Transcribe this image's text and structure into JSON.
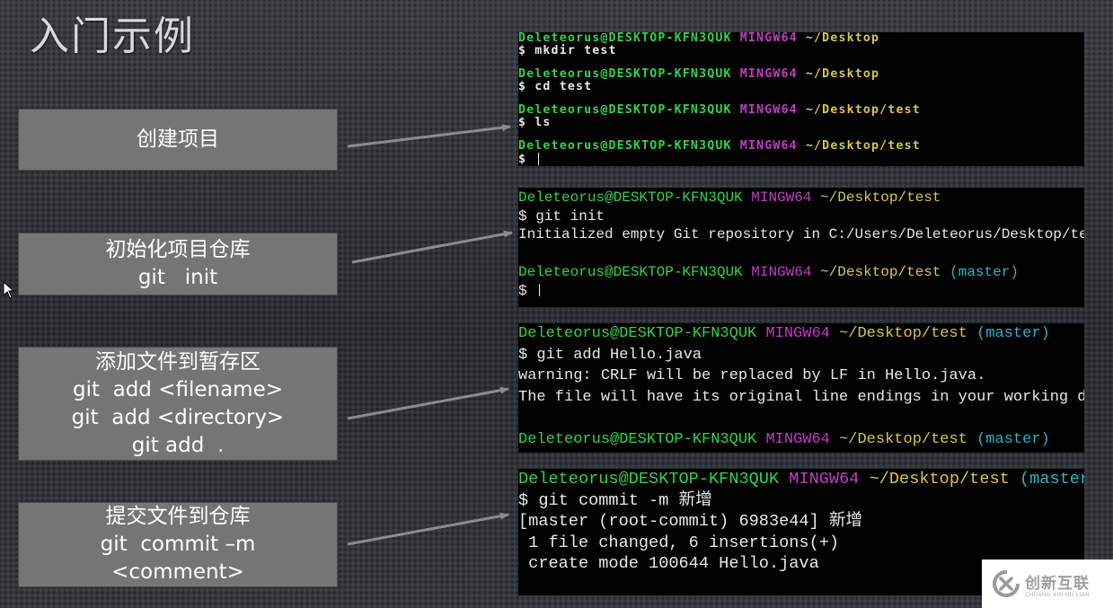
{
  "slide": {
    "title": "入门示例"
  },
  "steps": [
    {
      "lines": [
        "创建项目"
      ]
    },
    {
      "lines": [
        "初始化项目仓库",
        "git   init"
      ]
    },
    {
      "lines": [
        "添加文件到暂存区",
        "git  add <filename>",
        "git  add <directory>",
        "git add  ."
      ]
    },
    {
      "lines": [
        "提交文件到仓库",
        "git  commit –m",
        "<comment>"
      ]
    }
  ],
  "terminal1": {
    "prompt": {
      "user": "Deleteorus@DESKTOP-KFN3QUK",
      "shell": "MINGW64"
    },
    "blocks": [
      {
        "path": "~/Desktop",
        "command": "$ mkdir test"
      },
      {
        "path": "~/Desktop",
        "command": "$ cd test"
      },
      {
        "path": "~/Desktop/test",
        "command": "$ ls"
      },
      {
        "path": "~/Desktop/test",
        "command": "$ "
      }
    ]
  },
  "terminal2": {
    "prompt1": {
      "user": "Deleteorus@DESKTOP-KFN3QUK",
      "shell": "MINGW64",
      "path": "~/Desktop/test"
    },
    "command": "$ git init",
    "output": "Initialized empty Git repository in C:/Users/Deleteorus/Desktop/test/.git/",
    "prompt2": {
      "user": "Deleteorus@DESKTOP-KFN3QUK",
      "shell": "MINGW64",
      "path": "~/Desktop/test",
      "branch": "(master)"
    },
    "command2": "$ "
  },
  "terminal3": {
    "prompt1": {
      "user": "Deleteorus@DESKTOP-KFN3QUK",
      "shell": "MINGW64",
      "path": "~/Desktop/test",
      "branch": "(master)"
    },
    "command": "$ git add Hello.java",
    "output": [
      "warning: CRLF will be replaced by LF in Hello.java.",
      "The file will have its original line endings in your working directory."
    ],
    "prompt2": {
      "user": "Deleteorus@DESKTOP-KFN3QUK",
      "shell": "MINGW64",
      "path": "~/Desktop/test",
      "branch": "(master)"
    }
  },
  "terminal4": {
    "prompt1": {
      "user": "Deleteorus@DESKTOP-KFN3QUK",
      "shell": "MINGW64",
      "path": "~/Desktop/test",
      "branch": "(master)"
    },
    "command": "$ git commit -m 新增",
    "output": [
      "[master (root-commit) 6983e44] 新增",
      " 1 file changed, 6 insertions(+)",
      " create mode 100644 Hello.java"
    ]
  },
  "watermark": {
    "name": "创新互联",
    "subtitle": "CHUANG XIN HU LIAN"
  },
  "colors": {
    "prompt_user": "#2ed44a",
    "prompt_shell": "#c53ac5",
    "prompt_path": "#d7c64b",
    "prompt_branch": "#2fb0c6",
    "box_fill": "#757575"
  }
}
